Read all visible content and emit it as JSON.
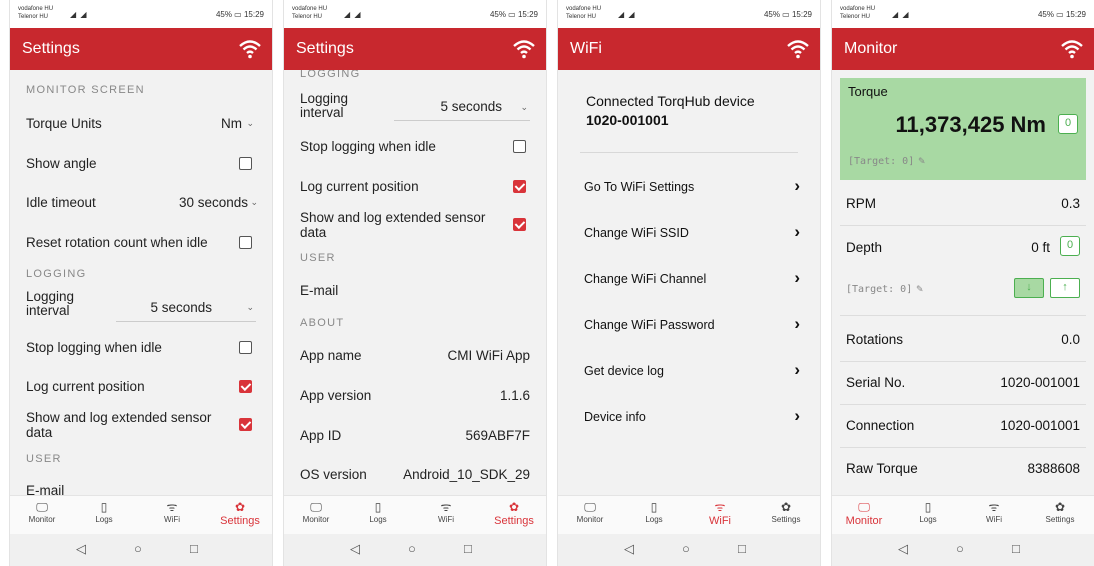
{
  "status": {
    "carrier1": "vodafone HU",
    "carrier2": "Telenor HU",
    "battery": "45%",
    "time": "15:29"
  },
  "nav": {
    "monitor": "Monitor",
    "logs": "Logs",
    "wifi": "WiFi",
    "settings": "Settings"
  },
  "screen1": {
    "title": "Settings",
    "monitor_section": "MONITOR SCREEN",
    "torque_units_label": "Torque Units",
    "torque_units_value": "Nm",
    "show_angle": "Show angle",
    "idle_timeout_label": "Idle timeout",
    "idle_timeout_value": "30 seconds",
    "reset_rotation": "Reset rotation count when idle",
    "logging_section": "LOGGING",
    "logging_interval_label": "Logging\ninterval",
    "logging_interval_value": "5 seconds",
    "stop_logging": "Stop logging when idle",
    "log_position": "Log current position",
    "show_log_extended": "Show and log extended sensor data",
    "user_section": "USER",
    "email": "E-mail"
  },
  "screen2": {
    "title": "Settings",
    "logging_section": "LOGGING",
    "logging_interval_label": "Logging\ninterval",
    "logging_interval_value": "5 seconds",
    "stop_logging": "Stop logging when idle",
    "log_position": "Log current position",
    "show_log_extended": "Show and log extended sensor data",
    "user_section": "USER",
    "email": "E-mail",
    "about_section": "ABOUT",
    "app_name_label": "App name",
    "app_name_value": "CMI WiFi App",
    "app_version_label": "App version",
    "app_version_value": "1.1.6",
    "app_id_label": "App ID",
    "app_id_value": "569ABF7F",
    "os_version_label": "OS version",
    "os_version_value": "Android_10_SDK_29"
  },
  "screen3": {
    "title": "WiFi",
    "connected_label": "Connected TorqHub device",
    "device_id": "1020-001001",
    "items": [
      "Go To WiFi Settings",
      "Change WiFi SSID",
      "Change WiFi Channel",
      "Change WiFi Password",
      "Get device log",
      "Device info"
    ]
  },
  "screen4": {
    "title": "Monitor",
    "torque_label": "Torque",
    "torque_value": "11,373,425 Nm",
    "torque_zero": "0",
    "torque_target": "[Target: 0]",
    "rpm_label": "RPM",
    "rpm_value": "0.3",
    "depth_label": "Depth",
    "depth_value": "0 ft",
    "depth_zero": "0",
    "depth_target": "[Target: 0]",
    "rotations_label": "Rotations",
    "rotations_value": "0.0",
    "serial_label": "Serial No.",
    "serial_value": "1020-001001",
    "connection_label": "Connection",
    "connection_value": "1020-001001",
    "raw_torque_label": "Raw Torque",
    "raw_torque_value": "8388608"
  },
  "colors": {
    "brand_red": "#c8282e",
    "accent_red": "#d9343a",
    "torque_green": "#a8d9a3",
    "zero_green": "#4caf50"
  }
}
